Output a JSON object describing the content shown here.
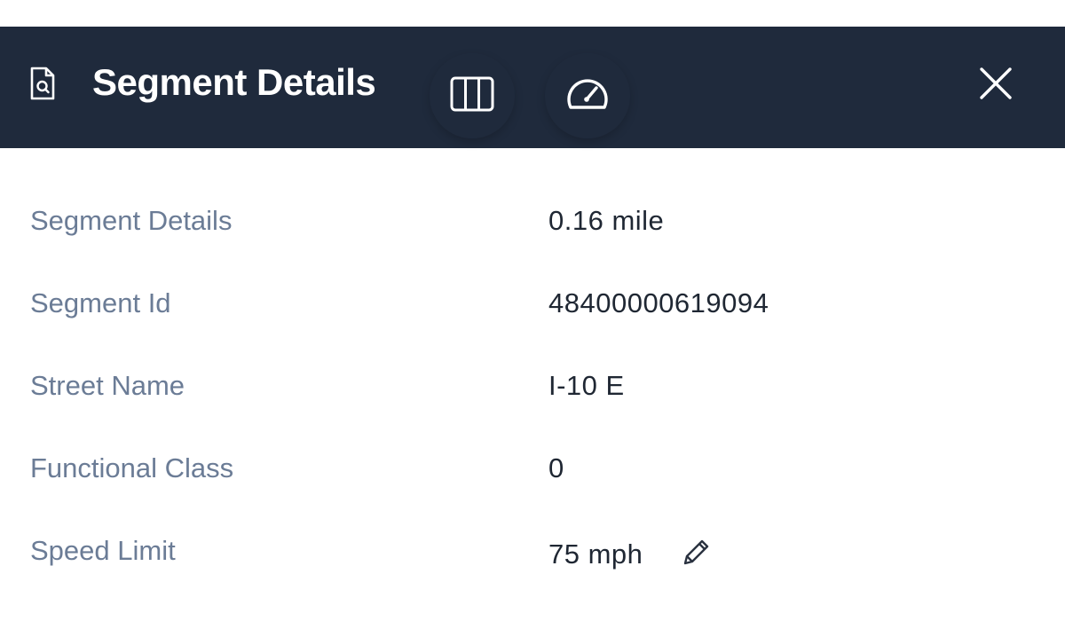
{
  "header": {
    "title": "Segment Details",
    "icons": {
      "document": "document-search-icon",
      "columns": "columns-icon",
      "gauge": "speedometer-icon",
      "close": "close-icon"
    },
    "background_color": "#1f2a3c"
  },
  "details": {
    "rows": [
      {
        "label": "Segment Details",
        "value": "0.16 mile"
      },
      {
        "label": "Segment Id",
        "value": "48400000619094"
      },
      {
        "label": "Street Name",
        "value": "I-10 E"
      },
      {
        "label": "Functional Class",
        "value": "0"
      },
      {
        "label": "Speed Limit",
        "value": "75 mph",
        "edit_icon": "pencil-icon"
      }
    ]
  },
  "colors": {
    "label": "#6b7c96",
    "value": "#1f2733"
  }
}
